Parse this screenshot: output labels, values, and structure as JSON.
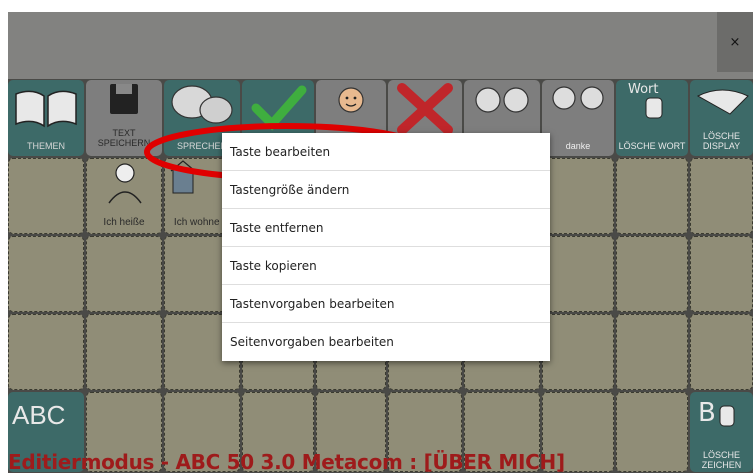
{
  "window": {
    "close_label": "×"
  },
  "toolbar": {
    "themen": "THEMEN",
    "text_speichern": "TEXT SPEICHERN",
    "sprechen": "SPRECHEN",
    "danke": "danke",
    "loesche_wort_top": "Wort",
    "loesche_wort": "LÖSCHE WORT",
    "loesche_display": "LÖSCHE DISPLAY"
  },
  "grid": {
    "ich_heisse": "Ich heiße",
    "ich_wohne_in": "Ich wohne in",
    "abc_label": "ABC",
    "loesche_zeichen_top": "B",
    "loesche_zeichen": "LÖSCHE ZEICHEN"
  },
  "context_menu": {
    "items": [
      "Taste bearbeiten",
      "Tastengröße ändern",
      "Taste entfernen",
      "Taste kopieren",
      "Tastenvorgaben bearbeiten",
      "Seitenvorgaben bearbeiten"
    ]
  },
  "status": {
    "text": "Editiermodus - ABC 50 3.0 Metacom : [ÜBER MICH]"
  },
  "colors": {
    "toolbar_teal": "#3d6a68",
    "grid_beige": "#908d77",
    "status_red": "#9e1b1b",
    "highlight_red": "#e00000"
  }
}
